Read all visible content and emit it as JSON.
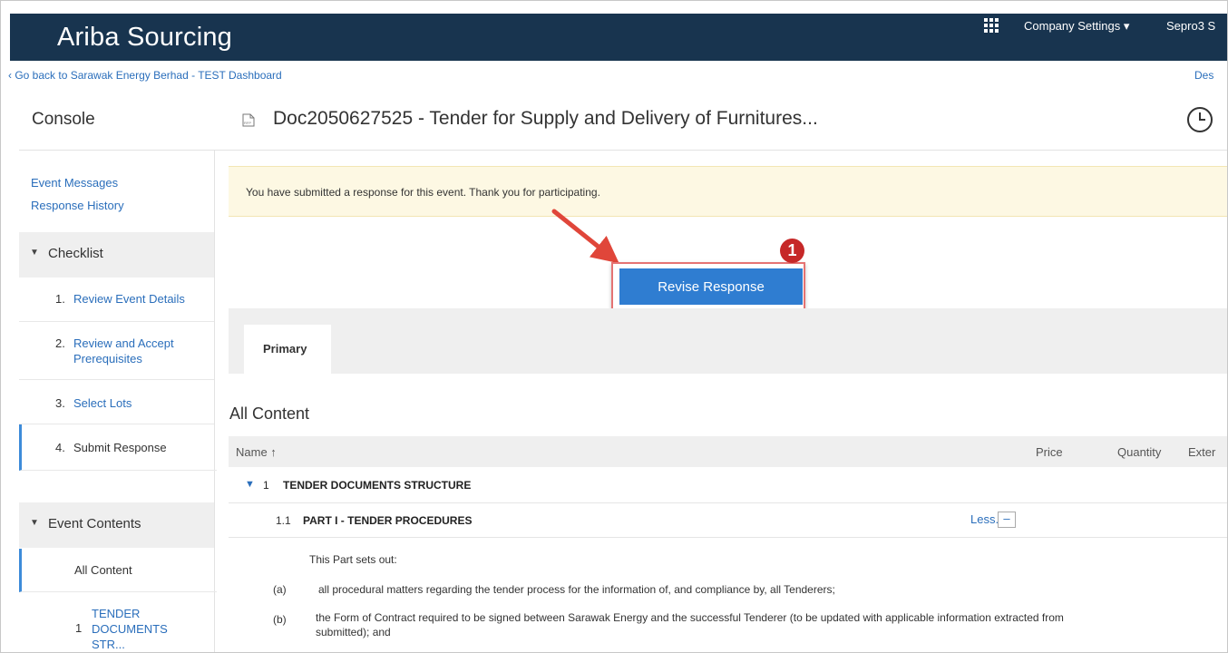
{
  "header": {
    "app_title": "Ariba Sourcing",
    "company_settings": "Company Settings ▾",
    "user_menu": "Sepro3 S",
    "back_link": "‹ Go back to Sarawak Energy Berhad - TEST Dashboard",
    "right_link": "Des"
  },
  "sidebar": {
    "title": "Console",
    "links": [
      "Event Messages",
      "Response History"
    ],
    "checklist_label": "Checklist",
    "checklist": [
      {
        "num": "1.",
        "label": "Review Event Details"
      },
      {
        "num": "2.",
        "label": "Review and Accept Prerequisites"
      },
      {
        "num": "3.",
        "label": "Select Lots"
      },
      {
        "num": "4.",
        "label": "Submit Response"
      }
    ],
    "event_contents_label": "Event Contents",
    "event_contents": [
      {
        "num": "",
        "label": "All Content"
      },
      {
        "num": "1",
        "label": "TENDER DOCUMENTS STR..."
      }
    ]
  },
  "main": {
    "doc_title": "Doc2050627525 - Tender for Supply and Delivery of Furnitures...",
    "banner": "You have submitted a response for this event.  Thank you for participating.",
    "revise_button": "Revise Response",
    "step_badge": "1",
    "tab_primary": "Primary",
    "section_title": "All Content",
    "table": {
      "columns": [
        "Name ↑",
        "Price",
        "Quantity",
        "Exter"
      ],
      "rows": [
        {
          "num": "1",
          "label": "TENDER DOCUMENTS STRUCTURE"
        },
        {
          "num": "1.1",
          "label": "PART I - TENDER PROCEDURES",
          "less": "Less...",
          "collapse": "–"
        }
      ]
    },
    "body": {
      "intro": "This Part sets out:",
      "items": [
        {
          "marker": "(a)",
          "text": "all procedural matters regarding the tender process for the information of, and compliance by, all Tenderers;"
        },
        {
          "marker": "(b)",
          "text": "the Form of Contract required to be signed between Sarawak Energy and the successful Tenderer (to be updated with applicable information extracted from",
          "continuation": "submitted); and"
        }
      ]
    }
  },
  "colors": {
    "topbar": "#18344f",
    "primary_button": "#2f7dd1",
    "link": "#2a6ebb",
    "banner_bg": "#fdf8e3",
    "annotation": "#e0463a"
  }
}
